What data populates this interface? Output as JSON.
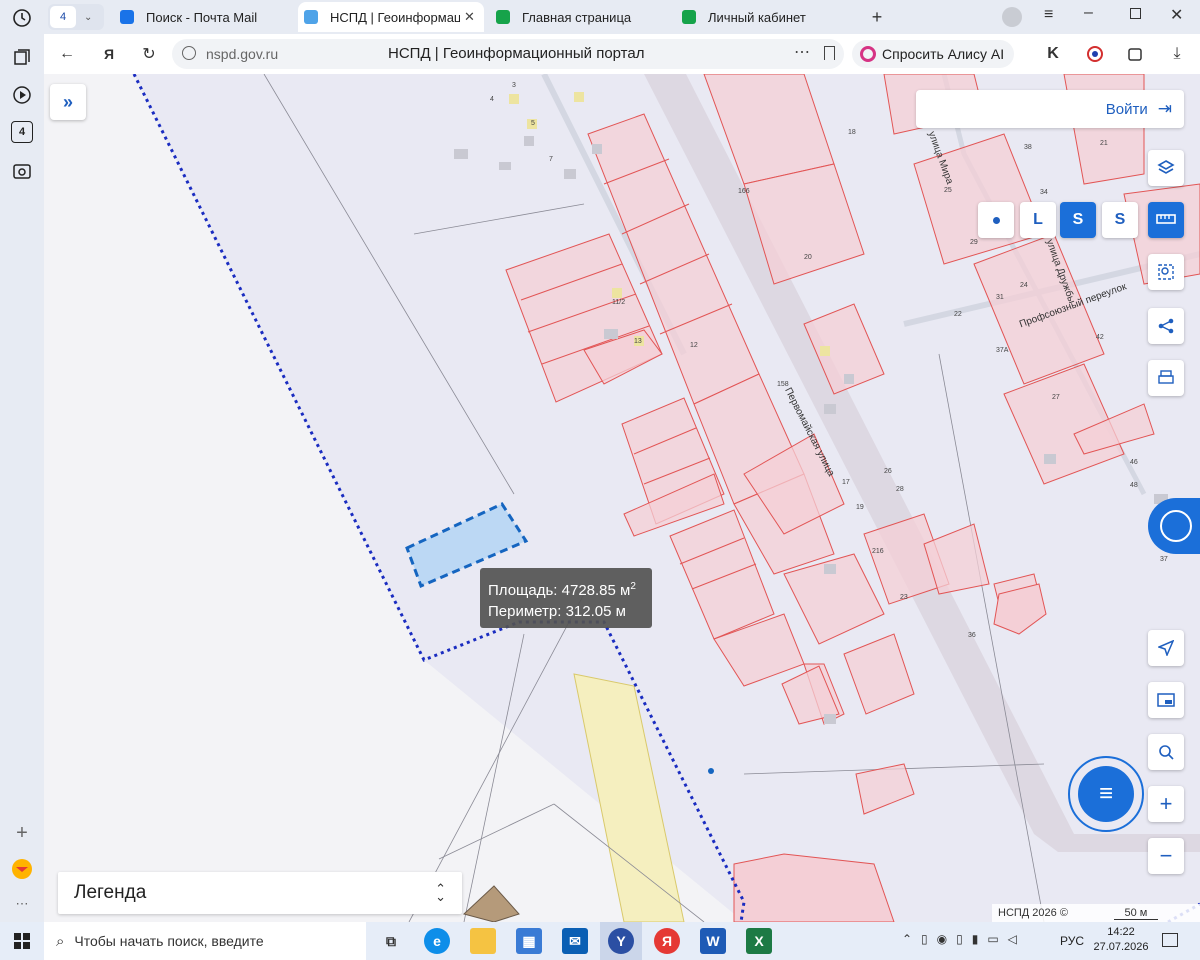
{
  "browser": {
    "tab_count": "4",
    "tabs": [
      {
        "label": "Поиск - Почта Mail",
        "active": false
      },
      {
        "label": "НСПД | Геоинформаци",
        "active": true
      },
      {
        "label": "Главная страница",
        "active": false
      },
      {
        "label": "Личный кабинет",
        "active": false
      }
    ],
    "url": "nspd.gov.ru",
    "page_title": "НСПД | Геоинформационный портал",
    "alice_label": "Спросить Алису AI",
    "sidebar_badge": "4"
  },
  "map": {
    "login_label": "Войти",
    "measure_area_label": "Площадь:",
    "measure_area_value": "4728.85 м",
    "measure_area_sup": "2",
    "measure_perimeter_label": "Периметр:",
    "measure_perimeter_value": "312.05 м",
    "legend_label": "Легенда",
    "copyright": "НСПД 2026 ©",
    "scale_label": "50 м",
    "street_labels": [
      "Первомайская улица",
      "Профсоюзный переулок",
      "улица Мира",
      "улица Дружбы"
    ],
    "building_numbers": [
      "166",
      "158",
      "12",
      "13",
      "11/2",
      "216",
      "17",
      "19",
      "25",
      "26",
      "28",
      "23",
      "36",
      "29",
      "22",
      "18",
      "37A",
      "27",
      "24",
      "31",
      "42",
      "46",
      "48",
      "37",
      "21",
      "38",
      "34",
      "5",
      "7",
      "4",
      "3",
      "20"
    ]
  },
  "taskbar": {
    "search_placeholder": "Чтобы начать поиск, введите",
    "language": "РУС",
    "time": "14:22",
    "date": "27.07.2026"
  },
  "colors": {
    "accent": "#1b6fd9",
    "parcel": "#e25555",
    "parcel_fill": "#f7d4d8",
    "selection": "#1565c0"
  }
}
